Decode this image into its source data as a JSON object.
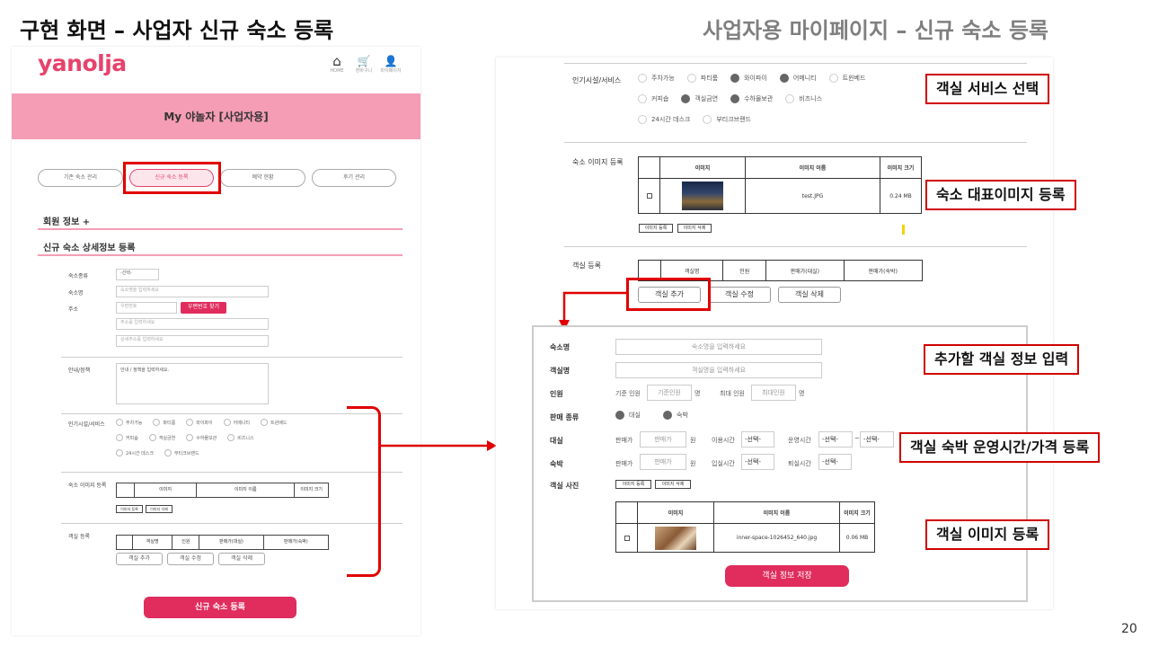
{
  "slide": {
    "title_left": "구현 화면 – 사업자 신규 숙소 등록",
    "title_right": "사업자용 마이페이지 – 신규 숙소 등록",
    "page_number": "20"
  },
  "left": {
    "logo": "yanolja",
    "nav": [
      {
        "icon": "home-icon",
        "glyph": "⌂",
        "label": "HOME"
      },
      {
        "icon": "cart-icon",
        "glyph": "🛒",
        "label": "장바구니"
      },
      {
        "icon": "user-icon",
        "glyph": "👤",
        "label": "마이페이지"
      }
    ],
    "header_title": "My 야놀자 [사업자용]",
    "tabs": [
      "기존 숙소 관리",
      "신규 숙소 등록",
      "예약 현황",
      "후기 관리"
    ],
    "member_info": "회원 정보 +",
    "section_title": "신규 숙소 상세정보 등록",
    "form": {
      "type_label": "숙소종류",
      "type_value": "-선택-",
      "name_label": "숙소명",
      "name_placeholder": "숙소명을 입력하세요",
      "addr_label": "주소",
      "zip_placeholder": "우편번호",
      "zip_button": "우편번호 찾기",
      "addr1_placeholder": "주소를 입력하세요",
      "addr2_placeholder": "상세주소를 입력하세요",
      "guide_label": "안내/정책",
      "guide_text": "안내 / 정책을 입력하세요.",
      "facility_label": "인기시설/서비스",
      "facility_rows": [
        [
          "주차가능",
          "파티룸",
          "와이파이",
          "어메니티",
          "트윈베드"
        ],
        [
          "커피숍",
          "객실금연",
          "수하물보관",
          "비즈니스"
        ],
        [
          "24시간 데스크",
          "부티크브랜드"
        ]
      ],
      "image_label": "숙소 이미지 등록",
      "image_headers": [
        "",
        "이미지",
        "이미지 이름",
        "이미지 크기"
      ],
      "image_btn_add": "이미지 등록",
      "image_btn_del": "이미지 삭제",
      "room_label": "객실 등록",
      "room_headers": [
        "",
        "객실명",
        "인원",
        "판매가(대실)",
        "판매가(숙박)"
      ],
      "room_btns": [
        "객실 추가",
        "객실 수정",
        "객실 삭제"
      ],
      "submit": "신규 숙소 등록"
    }
  },
  "right": {
    "facility_label": "인기시설/서비스",
    "facility_rows": [
      [
        {
          "t": "주차가능",
          "on": false
        },
        {
          "t": "파티룸",
          "on": false
        },
        {
          "t": "와이파이",
          "on": true
        },
        {
          "t": "어메니티",
          "on": true
        },
        {
          "t": "트윈베드",
          "on": false
        }
      ],
      [
        {
          "t": "커피숍",
          "on": false
        },
        {
          "t": "객실금연",
          "on": true
        },
        {
          "t": "수하물보관",
          "on": true
        },
        {
          "t": "비즈니스",
          "on": false
        }
      ],
      [
        {
          "t": "24시간 데스크",
          "on": false
        },
        {
          "t": "부티크브랜드",
          "on": false
        }
      ]
    ],
    "image_label": "숙소 이미지 등록",
    "image_headers": [
      "",
      "이미지",
      "이미지 이름",
      "이미지 크기"
    ],
    "image_row": {
      "name": "test.JPG",
      "size": "0.24 MB"
    },
    "image_btn_add": "이미지 등록",
    "image_btn_del": "이미지 삭제",
    "room_label": "객실 등록",
    "room_headers": [
      "",
      "객실명",
      "인원",
      "판매가(대실)",
      "판매가(숙박)"
    ],
    "room_btns": [
      "객실 추가",
      "객실 수정",
      "객실 삭제"
    ],
    "form": {
      "lodging_label": "숙소명",
      "lodging_placeholder": "숙소명을 입력하세요",
      "room_label": "객실명",
      "room_placeholder": "객실명을 입력하세요",
      "people_label": "인원",
      "base_label": "기준 인원",
      "base_placeholder": "기준인원",
      "max_label": "최대 인원",
      "max_placeholder": "최대인원",
      "unit_people": "명",
      "sale_label": "판매 종류",
      "sale_opts": [
        "대실",
        "숙박"
      ],
      "daystay_label": "대실",
      "price_label": "판매가",
      "price_placeholder": "판매가",
      "won": "원",
      "use_time_label": "이용시간",
      "op_time_label": "운영시간",
      "select": "-선택-",
      "tilde": "~",
      "overnight_label": "숙박",
      "checkin_label": "입실시간",
      "checkout_label": "퇴실시간",
      "photo_label": "객실 사진",
      "photo_btn_add": "이미지 등록",
      "photo_btn_del": "이미지 삭제",
      "photo_headers": [
        "",
        "이미지",
        "이미지 이름",
        "이미지 크기"
      ],
      "photo_row": {
        "name": "inner-space-1026452_640.jpg",
        "size": "0.06 MB"
      },
      "save": "객실 정보 저장"
    }
  },
  "annotations": {
    "a1": "객실 서비스 선택",
    "a2": "숙소 대표이미지 등록",
    "a3": "추가할 객실 정보 입력",
    "a4": "객실 숙박 운영시간/가격 등록",
    "a5": "객실 이미지 등록"
  },
  "colors": {
    "brand_pink": "#e6436d",
    "header_pink": "#f59db5",
    "button_pink": "#e02d5d",
    "annotation_red": "#e00000"
  }
}
